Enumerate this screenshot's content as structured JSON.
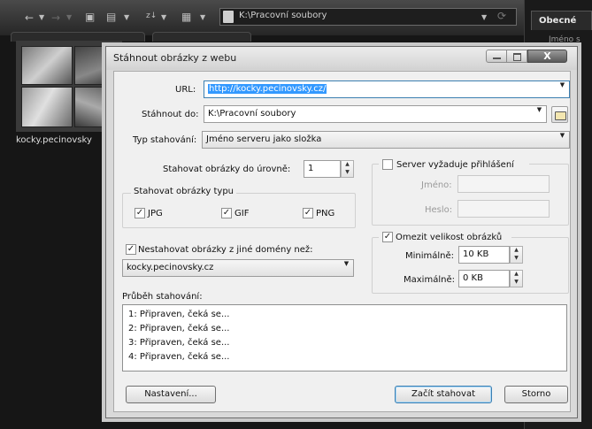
{
  "background": {
    "address_path": "K:\\Pracovní soubory",
    "tab_obecne": "Obecné",
    "column_jmeno": "Jméno s",
    "folder_label": "kocky.pecinovsky"
  },
  "dialog": {
    "title": "Stáhnout obrázky z webu",
    "url_label": "URL:",
    "url_value": "http://kocky.pecinovsky.cz/",
    "download_to_label": "Stáhnout do:",
    "download_to_value": "K:\\Pracovní soubory",
    "type_label": "Typ stahování:",
    "type_value": "Jméno serveru jako složka",
    "level_label": "Stahovat obrázky do úrovně:",
    "level_value": "1",
    "types_group_label": "Stahovat obrázky typu",
    "types": [
      {
        "label": "JPG",
        "checked": true
      },
      {
        "label": "GIF",
        "checked": true
      },
      {
        "label": "PNG",
        "checked": true
      }
    ],
    "login": {
      "label": "Server vyžaduje přihlášení",
      "checked": false,
      "name_label": "Jméno:",
      "password_label": "Heslo:"
    },
    "domain_label": "Nestahovat obrázky z jiné domény než:",
    "domain_checked": true,
    "domain_value": "kocky.pecinovsky.cz",
    "size": {
      "label": "Omezit velikost obrázků",
      "checked": true,
      "min_label": "Minimálně:",
      "min_value": "10 KB",
      "max_label": "Maximálně:",
      "max_value": "0 KB"
    },
    "progress_label": "Průběh stahování:",
    "log": [
      "1: Připraven, čeká se...",
      "2: Připraven, čeká se...",
      "3: Připraven, čeká se...",
      "4: Připraven, čeká se..."
    ],
    "buttons": {
      "settings": "Nastavení...",
      "start": "Začít stahovat",
      "cancel": "Storno",
      "close": "X"
    }
  }
}
